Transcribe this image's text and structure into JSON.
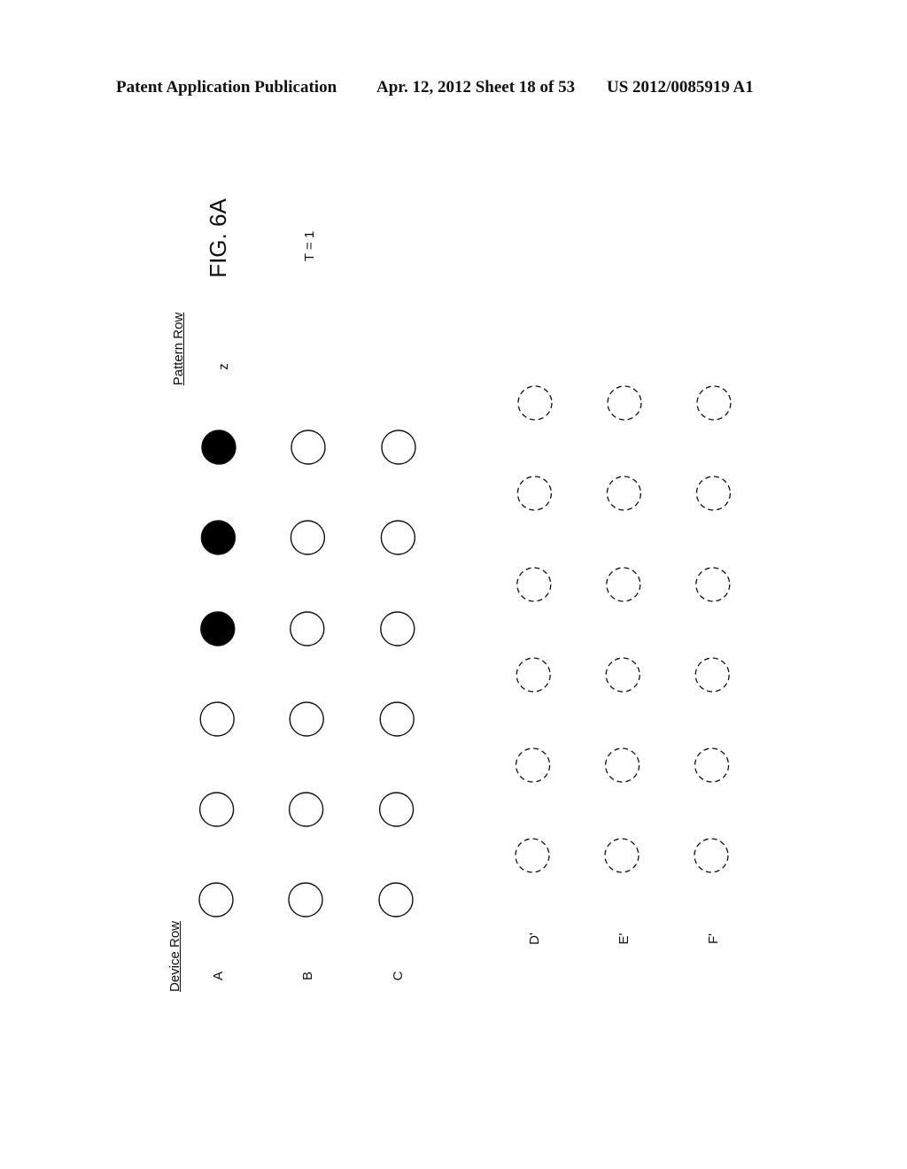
{
  "header": {
    "left": "Patent Application Publication",
    "middle": "Apr. 12, 2012  Sheet 18 of 53",
    "right": "US 2012/0085919 A1"
  },
  "figure": {
    "title": "FIG. 6A",
    "time_label": "T = 1",
    "pattern_row_label": "Pattern Row",
    "pattern_row_value": "z",
    "device_row_label": "Device Row"
  },
  "device_rows": [
    {
      "label": "A",
      "states": [
        "filled",
        "filled",
        "filled",
        "empty",
        "empty",
        "empty"
      ]
    },
    {
      "label": "B",
      "states": [
        "empty",
        "empty",
        "empty",
        "empty",
        "empty",
        "empty"
      ]
    },
    {
      "label": "C",
      "states": [
        "empty",
        "empty",
        "empty",
        "empty",
        "empty",
        "empty"
      ]
    }
  ],
  "virtual_rows": [
    {
      "label": "D'",
      "states": [
        "dashed",
        "dashed",
        "dashed",
        "dashed",
        "dashed",
        "dashed"
      ]
    },
    {
      "label": "E'",
      "states": [
        "dashed",
        "dashed",
        "dashed",
        "dashed",
        "dashed",
        "dashed"
      ]
    },
    {
      "label": "F'",
      "states": [
        "dashed",
        "dashed",
        "dashed",
        "dashed",
        "dashed",
        "dashed"
      ]
    }
  ]
}
